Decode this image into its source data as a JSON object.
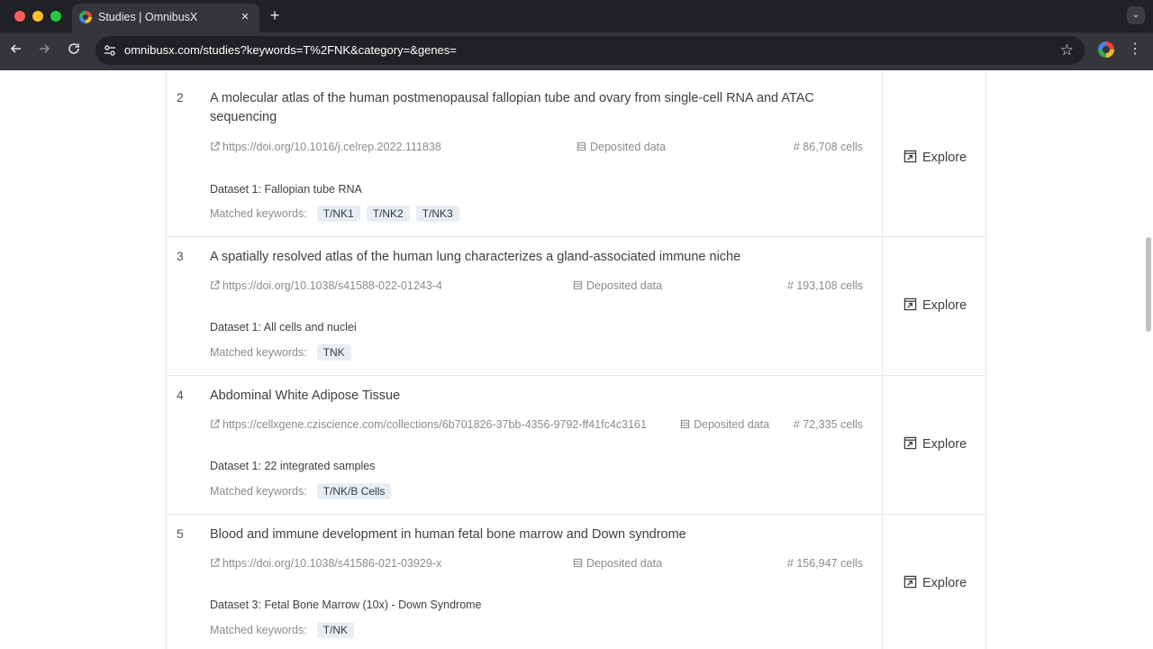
{
  "browser": {
    "tab_title": "Studies | OmnibusX",
    "tab_close": "×",
    "new_tab": "+",
    "url": "omnibusx.com/studies?keywords=T%2FNK&category=&genes="
  },
  "studies": [
    {
      "index": "2",
      "title": "A molecular atlas of the human postmenopausal fallopian tube and ovary from single-cell RNA and ATAC sequencing",
      "link": "https://doi.org/10.1016/j.celrep.2022.111838",
      "deposited": "Deposited data",
      "cells": "# 86,708 cells",
      "dataset": "Dataset 1: Fallopian tube RNA",
      "matched_label": "Matched keywords:",
      "keywords": [
        "T/NK1",
        "T/NK2",
        "T/NK3"
      ],
      "explore": "Explore"
    },
    {
      "index": "3",
      "title": "A spatially resolved atlas of the human lung characterizes a gland-associated immune niche",
      "link": "https://doi.org/10.1038/s41588-022-01243-4",
      "deposited": "Deposited data",
      "cells": "# 193,108 cells",
      "dataset": "Dataset 1: All cells and nuclei",
      "matched_label": "Matched keywords:",
      "keywords": [
        "TNK"
      ],
      "explore": "Explore"
    },
    {
      "index": "4",
      "title": "Abdominal White Adipose Tissue",
      "link": "https://cellxgene.cziscience.com/collections/6b701826-37bb-4356-9792-ff41fc4c3161",
      "deposited": "Deposited data",
      "cells": "# 72,335 cells",
      "dataset": "Dataset 1: 22 integrated samples",
      "matched_label": "Matched keywords:",
      "keywords": [
        "T/NK/B Cells"
      ],
      "explore": "Explore"
    },
    {
      "index": "5",
      "title": "Blood and immune development in human fetal bone marrow and Down syndrome",
      "link": "https://doi.org/10.1038/s41586-021-03929-x",
      "deposited": "Deposited data",
      "cells": "# 156,947 cells",
      "dataset": "Dataset 3: Fetal Bone Marrow (10x) - Down Syndrome",
      "matched_label": "Matched keywords:",
      "keywords": [
        "T/NK"
      ],
      "explore": "Explore"
    }
  ]
}
